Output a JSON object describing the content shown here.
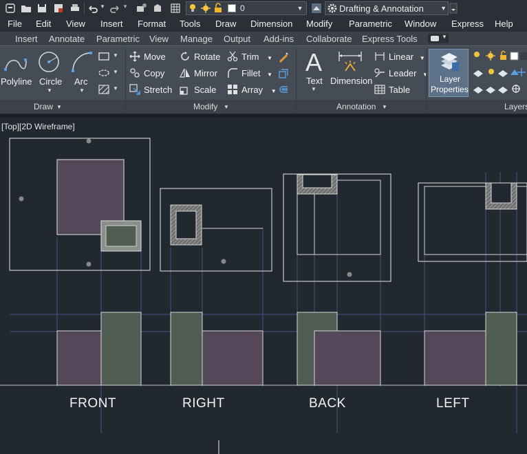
{
  "quick_access": {
    "layer_name": "0",
    "workspace": "Drafting & Annotation"
  },
  "menu": [
    "File",
    "Edit",
    "View",
    "Insert",
    "Format",
    "Tools",
    "Draw",
    "Dimension",
    "Modify",
    "Parametric",
    "Window",
    "Express",
    "Help"
  ],
  "ribbon_tabs": [
    "Insert",
    "Annotate",
    "Parametric",
    "View",
    "Manage",
    "Output",
    "Add-ins",
    "Collaborate",
    "Express Tools"
  ],
  "ribbon": {
    "draw": {
      "title": "Draw",
      "polyline": "Polyline",
      "circle": "Circle",
      "arc": "Arc"
    },
    "modify": {
      "title": "Modify",
      "move": "Move",
      "rotate": "Rotate",
      "trim": "Trim",
      "copy": "Copy",
      "mirror": "Mirror",
      "fillet": "Fillet",
      "stretch": "Stretch",
      "scale": "Scale",
      "array": "Array"
    },
    "annotation": {
      "title": "Annotation",
      "text": "Text",
      "dimension": "Dimension",
      "linear": "Linear",
      "leader": "Leader",
      "table": "Table"
    },
    "layers": {
      "title": "Layers",
      "layer_properties_line1": "Layer",
      "layer_properties_line2": "Properties"
    }
  },
  "drawing": {
    "viewport_label": "[Top][2D Wireframe]",
    "views": [
      "FRONT",
      "RIGHT",
      "BACK",
      "LEFT"
    ]
  },
  "colors": {
    "canvas": "#212830",
    "purple_fill": "#54475a",
    "green_fill": "#4f5d52",
    "hatch": "#8a8a8a",
    "construction_line": "#4b4f88"
  }
}
